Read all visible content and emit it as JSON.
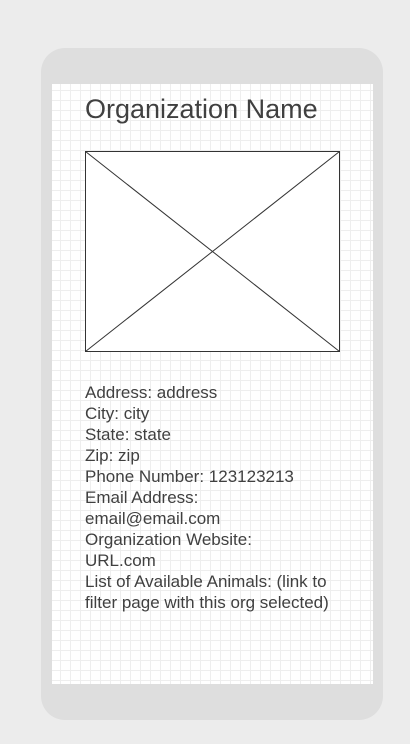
{
  "organization": {
    "name": "Organization Name"
  },
  "details": {
    "address": "Address: address",
    "city": "City: city",
    "state": "State: state",
    "zip": "Zip: zip",
    "phone": "Phone Number: 123123213",
    "email_label": "Email Address:",
    "email_value": "email@email.com",
    "website_label": "Organization Website:",
    "website_value": "URL.com",
    "animals": "List of Available Animals: (link to filter page with this org selected)"
  },
  "colors": {
    "background": "#ececec",
    "phone_frame": "#dedede",
    "screen": "#ffffff",
    "grid": "#eeeeee",
    "text": "#404040",
    "placeholder_stroke": "#333333"
  },
  "icons": {
    "image_placeholder": "image-placeholder-icon"
  }
}
